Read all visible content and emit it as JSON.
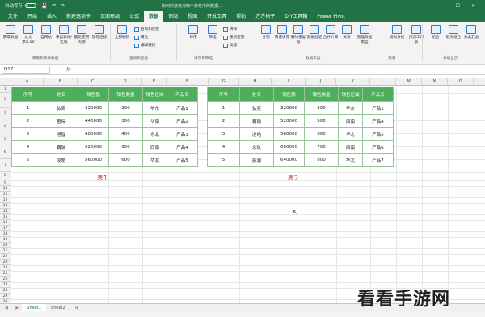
{
  "titlebar": {
    "autosave": "自动保存",
    "doc_title": "如何快速核对两个表格中的数据...",
    "window_controls": "— ☐ ✕"
  },
  "menu": {
    "tabs": [
      "文件",
      "开始",
      "插入",
      "新建选项卡",
      "页面布局",
      "公式",
      "数据",
      "审阅",
      "视图",
      "开发工具",
      "帮助",
      "方方格子",
      "DIY工具箱",
      "Power Pivot"
    ],
    "active": "数据"
  },
  "ribbon": {
    "buttons": [
      "获取数据",
      "从文本/CSV",
      "自网站",
      "来自表格/区域",
      "最近使用的源",
      "现有连接",
      "全部刷新",
      "排序",
      "筛选",
      "分列",
      "快速填充",
      "删除重复值",
      "数据验证",
      "合并计算",
      "关系",
      "管理数据模型",
      "模拟分析",
      "预测工作表",
      "组合",
      "取消组合",
      "分类汇总"
    ],
    "small": [
      "查询和连接",
      "属性",
      "编辑链接",
      "清除",
      "重新应用",
      "高级"
    ],
    "groups": [
      "获取和转换数据",
      "查询和连接",
      "排序和筛选",
      "数据工具",
      "预测",
      "分级显示"
    ]
  },
  "formula": {
    "namebox": "D17",
    "fx": "fx"
  },
  "columns": [
    "A",
    "B",
    "C",
    "D",
    "E",
    "F",
    "G",
    "H",
    "I",
    "J",
    "K",
    "L",
    "M",
    "N",
    "O",
    "P",
    "Q"
  ],
  "rows": [
    "1",
    "2",
    "3",
    "4",
    "5",
    "6",
    "7",
    "8",
    "9",
    "10",
    "11",
    "12",
    "13",
    "14",
    "15",
    "16",
    "17",
    "18",
    "19",
    "20",
    "21",
    "22",
    "23",
    "24",
    "25",
    "26",
    "27",
    "28",
    "29",
    "30",
    "31",
    "32"
  ],
  "table1": {
    "headers": [
      "序号",
      "姓名",
      "销售额",
      "销售数量",
      "销售区域",
      "产品名"
    ],
    "rows": [
      [
        "1",
        "弘奕",
        "320000",
        "200",
        "华东",
        "产品1"
      ],
      [
        "2",
        "苗琛",
        "440000",
        "300",
        "华南",
        "产品2"
      ],
      [
        "3",
        "旭智",
        "480000",
        "400",
        "东北",
        "产品3"
      ],
      [
        "4",
        "霸瑞",
        "520000",
        "500",
        "西南",
        "产品4"
      ],
      [
        "5",
        "凌皓",
        "560000",
        "600",
        "华北",
        "产品5"
      ]
    ],
    "caption": "表1"
  },
  "table2": {
    "headers": [
      "序号",
      "姓名",
      "销售额",
      "销售数量",
      "销售区域",
      "产品名"
    ],
    "rows": [
      [
        "1",
        "弘奕",
        "320000",
        "200",
        "华东",
        "产品1"
      ],
      [
        "2",
        "霸瑞",
        "520000",
        "500",
        "西南",
        "产品4"
      ],
      [
        "3",
        "凌皓",
        "560000",
        "600",
        "华北",
        "产品5"
      ],
      [
        "4",
        "念玫",
        "600000",
        "700",
        "西南",
        "产品6"
      ],
      [
        "5",
        "宸瀚",
        "640000",
        "800",
        "华北",
        "产品7"
      ]
    ],
    "caption": "表2"
  },
  "sheets": [
    "Sheet1",
    "Sheet2"
  ],
  "active_sheet": "Sheet1",
  "watermark": "看看手游网",
  "colors": {
    "excel_green": "#217346",
    "table_header": "#4eae5b",
    "caption_red": "#c0392b"
  }
}
